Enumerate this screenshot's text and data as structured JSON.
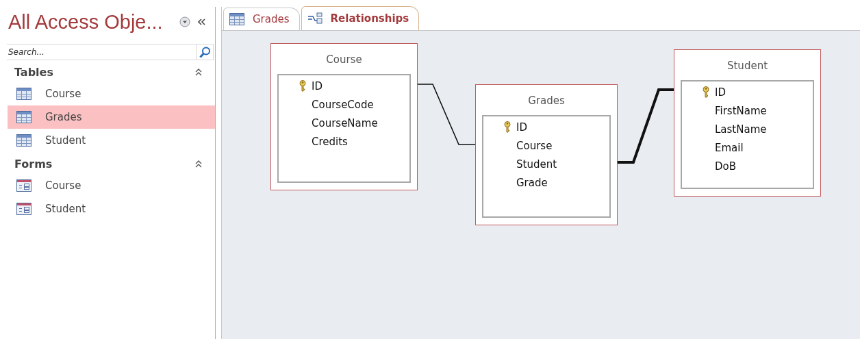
{
  "navigation_pane": {
    "title": "All Access Obje...",
    "search": {
      "placeholder": "Search..."
    },
    "groups": [
      {
        "label": "Tables",
        "expanded": true,
        "items": [
          {
            "label": "Course",
            "kind": "table",
            "selected": false
          },
          {
            "label": "Grades",
            "kind": "table",
            "selected": true
          },
          {
            "label": "Student",
            "kind": "table",
            "selected": false
          }
        ]
      },
      {
        "label": "Forms",
        "expanded": true,
        "items": [
          {
            "label": "Course",
            "kind": "form",
            "selected": false
          },
          {
            "label": "Student",
            "kind": "form",
            "selected": false
          }
        ]
      }
    ]
  },
  "tabs": [
    {
      "label": "Grades",
      "kind": "table",
      "selected": false
    },
    {
      "label": "Relationships",
      "kind": "relationships",
      "selected": true
    }
  ],
  "relationship_tables": [
    {
      "title": "Course",
      "fields": [
        {
          "name": "ID",
          "primary_key": true
        },
        {
          "name": "CourseCode",
          "primary_key": false
        },
        {
          "name": "CourseName",
          "primary_key": false
        },
        {
          "name": "Credits",
          "primary_key": false
        }
      ]
    },
    {
      "title": "Grades",
      "fields": [
        {
          "name": "ID",
          "primary_key": true
        },
        {
          "name": "Course",
          "primary_key": false
        },
        {
          "name": "Student",
          "primary_key": false
        },
        {
          "name": "Grade",
          "primary_key": false
        }
      ]
    },
    {
      "title": "Student",
      "fields": [
        {
          "name": "ID",
          "primary_key": true
        },
        {
          "name": "FirstName",
          "primary_key": false
        },
        {
          "name": "LastName",
          "primary_key": false
        },
        {
          "name": "Email",
          "primary_key": false
        },
        {
          "name": "DoB",
          "primary_key": false
        }
      ]
    }
  ],
  "relationships": [
    {
      "enforced": false
    },
    {
      "enforced": true
    }
  ]
}
